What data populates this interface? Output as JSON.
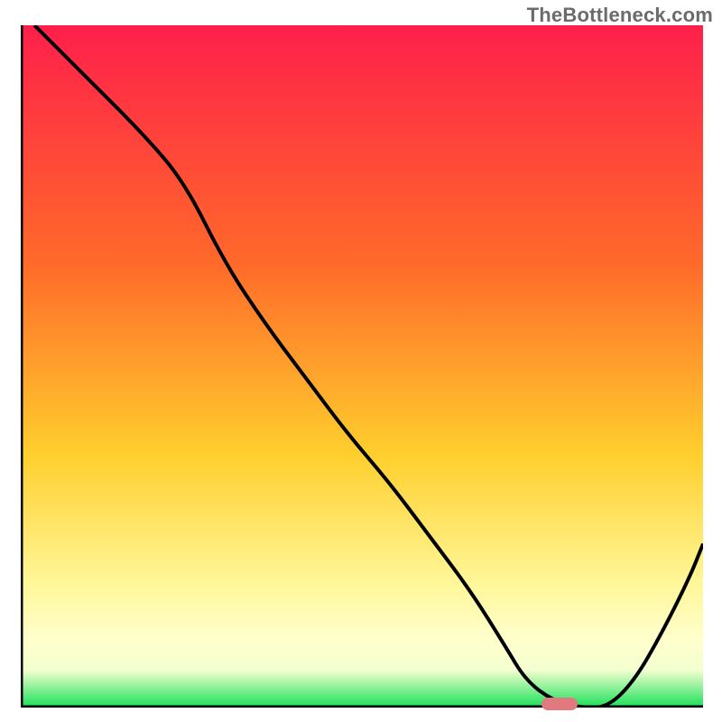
{
  "watermark": "TheBottleneck.com",
  "colors": {
    "curve": "#000000",
    "axis": "#000000",
    "marker": "#e07a7f",
    "grad_top": "#ff1f4b",
    "grad_mid1": "#ff6a2a",
    "grad_mid2": "#ffcf2d",
    "grad_mid3": "#fff79a",
    "grad_mid35": "#ffffcc",
    "grad_mid4": "#f4ffd0",
    "grad_bot": "#18e058"
  },
  "chart_data": {
    "type": "line",
    "title": "",
    "xlabel": "",
    "ylabel": "",
    "xlim": [
      0,
      100
    ],
    "ylim": [
      0,
      100
    ],
    "x": [
      2,
      10,
      18,
      24,
      30,
      36,
      42,
      48,
      54,
      60,
      66,
      71,
      74,
      78,
      82,
      86,
      90,
      94,
      98,
      100
    ],
    "values": [
      100,
      92,
      84,
      77,
      65,
      56,
      48,
      40,
      33,
      25,
      17,
      9,
      4,
      1,
      0,
      0,
      4,
      11,
      19,
      24
    ],
    "marker": {
      "x": 79,
      "y": 0.5
    },
    "gradient_stops": [
      {
        "pos": 0.0,
        "color": "grad_top"
      },
      {
        "pos": 0.35,
        "color": "grad_mid1"
      },
      {
        "pos": 0.63,
        "color": "grad_mid2"
      },
      {
        "pos": 0.82,
        "color": "grad_mid3"
      },
      {
        "pos": 0.9,
        "color": "grad_mid35"
      },
      {
        "pos": 0.945,
        "color": "grad_mid4"
      },
      {
        "pos": 1.0,
        "color": "grad_bot"
      }
    ]
  }
}
